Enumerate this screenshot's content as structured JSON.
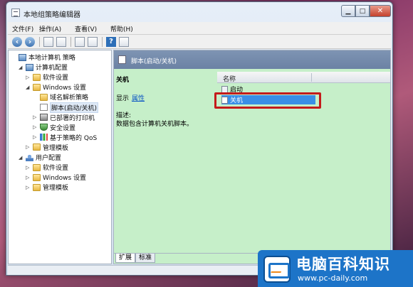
{
  "window": {
    "title": "本地组策略编辑器"
  },
  "menubar": {
    "items": [
      "文件(F)",
      "操作(A)",
      "查看(V)",
      "帮助(H)"
    ]
  },
  "tree": {
    "items": [
      {
        "label": "本地计算机 策略",
        "level": 0,
        "icon": "computer-policy-icon",
        "expander": ""
      },
      {
        "label": "计算机配置",
        "level": 1,
        "icon": "computer-icon",
        "expander": "◢"
      },
      {
        "label": "软件设置",
        "level": 2,
        "icon": "folder-icon",
        "expander": "▷"
      },
      {
        "label": "Windows 设置",
        "level": 2,
        "icon": "folder-icon",
        "expander": "◢"
      },
      {
        "label": "域名解析策略",
        "level": 3,
        "icon": "folder-icon",
        "expander": ""
      },
      {
        "label": "脚本(启动/关机)",
        "level": 3,
        "icon": "script-icon",
        "expander": "",
        "selected": true
      },
      {
        "label": "已部署的打印机",
        "level": 3,
        "icon": "printer-icon",
        "expander": "▷"
      },
      {
        "label": "安全设置",
        "level": 3,
        "icon": "shield-icon",
        "expander": "▷"
      },
      {
        "label": "基于策略的 QoS",
        "level": 3,
        "icon": "chart-icon",
        "expander": "▷"
      },
      {
        "label": "管理模板",
        "level": 2,
        "icon": "folder-icon",
        "expander": "▷"
      },
      {
        "label": "用户配置",
        "level": 1,
        "icon": "user-icon",
        "expander": "◢"
      },
      {
        "label": "软件设置",
        "level": 2,
        "icon": "folder-icon",
        "expander": "▷"
      },
      {
        "label": "Windows 设置",
        "level": 2,
        "icon": "folder-icon",
        "expander": "▷"
      },
      {
        "label": "管理模板",
        "level": 2,
        "icon": "folder-icon",
        "expander": "▷"
      }
    ]
  },
  "details": {
    "header": "脚本(启动/关机)",
    "section_title": "关机",
    "show_label": "显示",
    "properties_link": "属性",
    "description_label": "描述:",
    "description_text": "数据包含计算机关机脚本。"
  },
  "list": {
    "column_name": "名称",
    "items": [
      {
        "label": "启动",
        "selected": false
      },
      {
        "label": "关机",
        "selected": true
      }
    ]
  },
  "tabs": [
    "扩展",
    "标准"
  ],
  "watermark": {
    "name": "电脑百科知识",
    "url": "www.pc-daily.com"
  },
  "colors": {
    "selection": "#3a8ee6",
    "highlight_box": "#c41b1b",
    "pane_bg": "#c6efc9"
  }
}
